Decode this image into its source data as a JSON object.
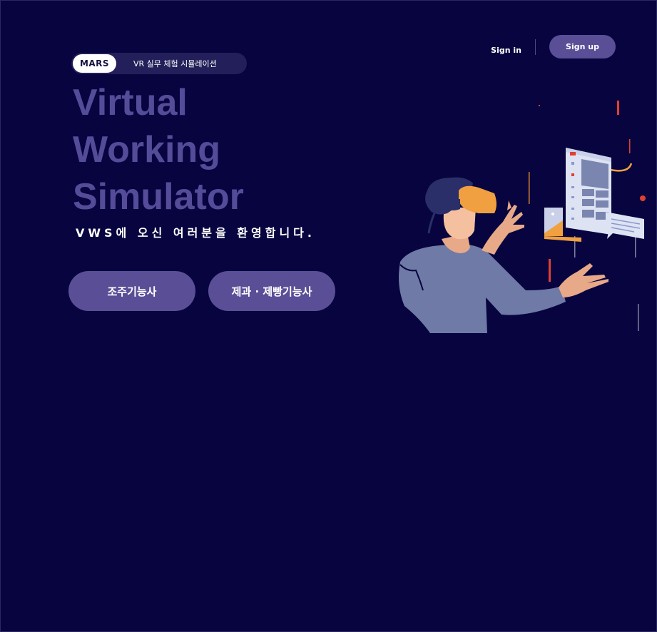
{
  "header": {
    "sign_in": "Sign in",
    "sign_up": "Sign up"
  },
  "badge": {
    "brand": "MARS",
    "text": "VR 실무 체험 시뮬레이션"
  },
  "hero": {
    "title_lines": [
      "Virtual",
      "Working",
      "Simulator"
    ],
    "welcome": "VWS에 오신 여러분을 환영합니다."
  },
  "actions": [
    {
      "label": "조주기능사"
    },
    {
      "label": "제과 · 제빵기능사"
    }
  ],
  "colors": {
    "background": "#07043f",
    "accent": "#5a4f96",
    "title": "#554c99",
    "orange": "#f0a040",
    "red": "#e04030"
  }
}
